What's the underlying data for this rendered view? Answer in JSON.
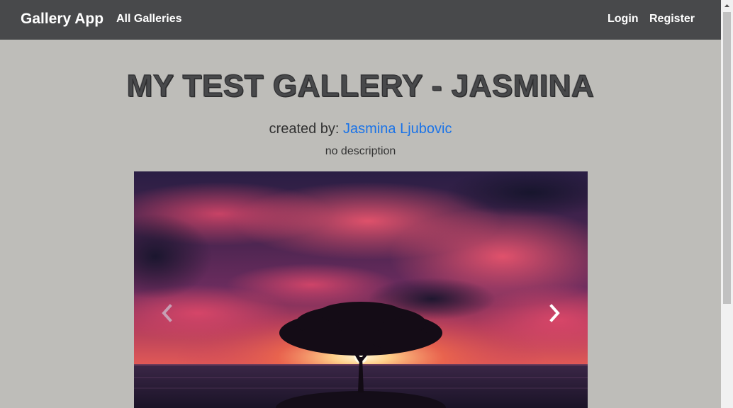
{
  "navbar": {
    "brand": "Gallery App",
    "all_galleries": "All Galleries",
    "login": "Login",
    "register": "Register"
  },
  "gallery": {
    "title": "MY TEST GALLERY - JASMINA",
    "created_by_label": "created by: ",
    "author": "Jasmina Ljubovic",
    "description": "no description"
  },
  "carousel": {
    "image": "sunset-tree-over-sea",
    "prev_icon": "chevron-left-icon",
    "next_icon": "chevron-right-icon"
  },
  "colors": {
    "navbar_bg": "#48494b",
    "page_bg": "#bebdb9",
    "link": "#1a73e8"
  }
}
